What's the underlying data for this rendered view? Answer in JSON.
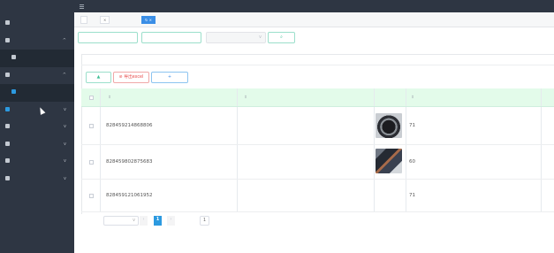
{
  "app": {
    "title": ""
  },
  "sidebar": {
    "items": [
      {
        "label": ""
      },
      {
        "label": ""
      },
      {
        "label": ""
      },
      {
        "label": ""
      },
      {
        "label": ""
      },
      {
        "label": ""
      },
      {
        "label": ""
      },
      {
        "label": ""
      },
      {
        "label": ""
      },
      {
        "label": ""
      },
      {
        "label": ""
      }
    ]
  },
  "topbar": {
    "breadcrumb": ""
  },
  "tabs": [
    {
      "label": ""
    },
    {
      "label": ""
    },
    {
      "label": ""
    }
  ],
  "search": {
    "field1_placeholder": "",
    "field2_placeholder": "",
    "select_placeholder": "",
    "query_label": ""
  },
  "panel": {
    "title": ""
  },
  "toolbar": {
    "print_label": "",
    "export_label": "⊘ 导出excel",
    "add_label": ""
  },
  "table": {
    "headers": {
      "number": "",
      "name": "",
      "image": "",
      "price": ""
    },
    "rows": [
      {
        "number": "828459214868806",
        "name": "",
        "price": "71"
      },
      {
        "number": "828459802875683",
        "name": "",
        "price": "60"
      },
      {
        "number": "828459121061952",
        "name": "",
        "price": "71"
      }
    ]
  },
  "pager": {
    "total": "",
    "page_size": "",
    "current_page": "1",
    "goto_label": "",
    "goto_value": "1",
    "page_suffix": ""
  },
  "colors": {
    "sidebar_bg": "#2e3643",
    "accent": "#3a8ee6",
    "header_row": "#e3fbea",
    "teal": "#3fbf95",
    "danger": "#e84c4c"
  }
}
